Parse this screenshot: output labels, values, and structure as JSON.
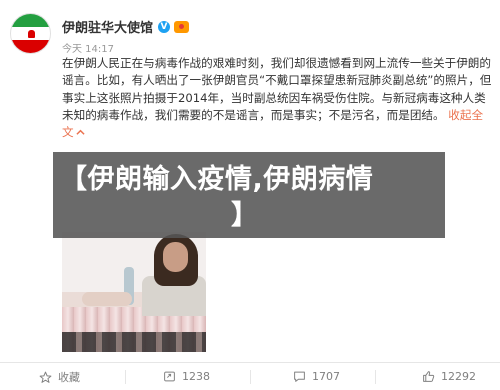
{
  "post": {
    "author": "伊朗驻华大使馆",
    "time": "今天 14:17",
    "body": "在伊朗人民正在与病毒作战的艰难时刻，我们却很遗憾看到网上流传一些关于伊朗的谣言。比如，有人晒出了一张伊朗官员“不戴口罩探望患新冠肺炎副总统”的照片，但事实上这张照片拍摄于2014年，当时副总统因车祸受伤住院。与新冠病毒这种人类未知的病毒作战，我们需要的不是谣言，而是事实；不是污名，而是团结。",
    "collapse_label": "收起全文",
    "collapse_icon": "chevron-up-icon"
  },
  "overlay": {
    "line1": "【伊朗输入疫情,伊朗病情",
    "line2": "】"
  },
  "actions": {
    "favorite_label": "收藏",
    "repost_count": "1238",
    "comment_count": "1707",
    "like_count": "12292"
  },
  "colors": {
    "link": "#eb7350",
    "verified": "#1da1f2",
    "overlay": "#555555"
  }
}
